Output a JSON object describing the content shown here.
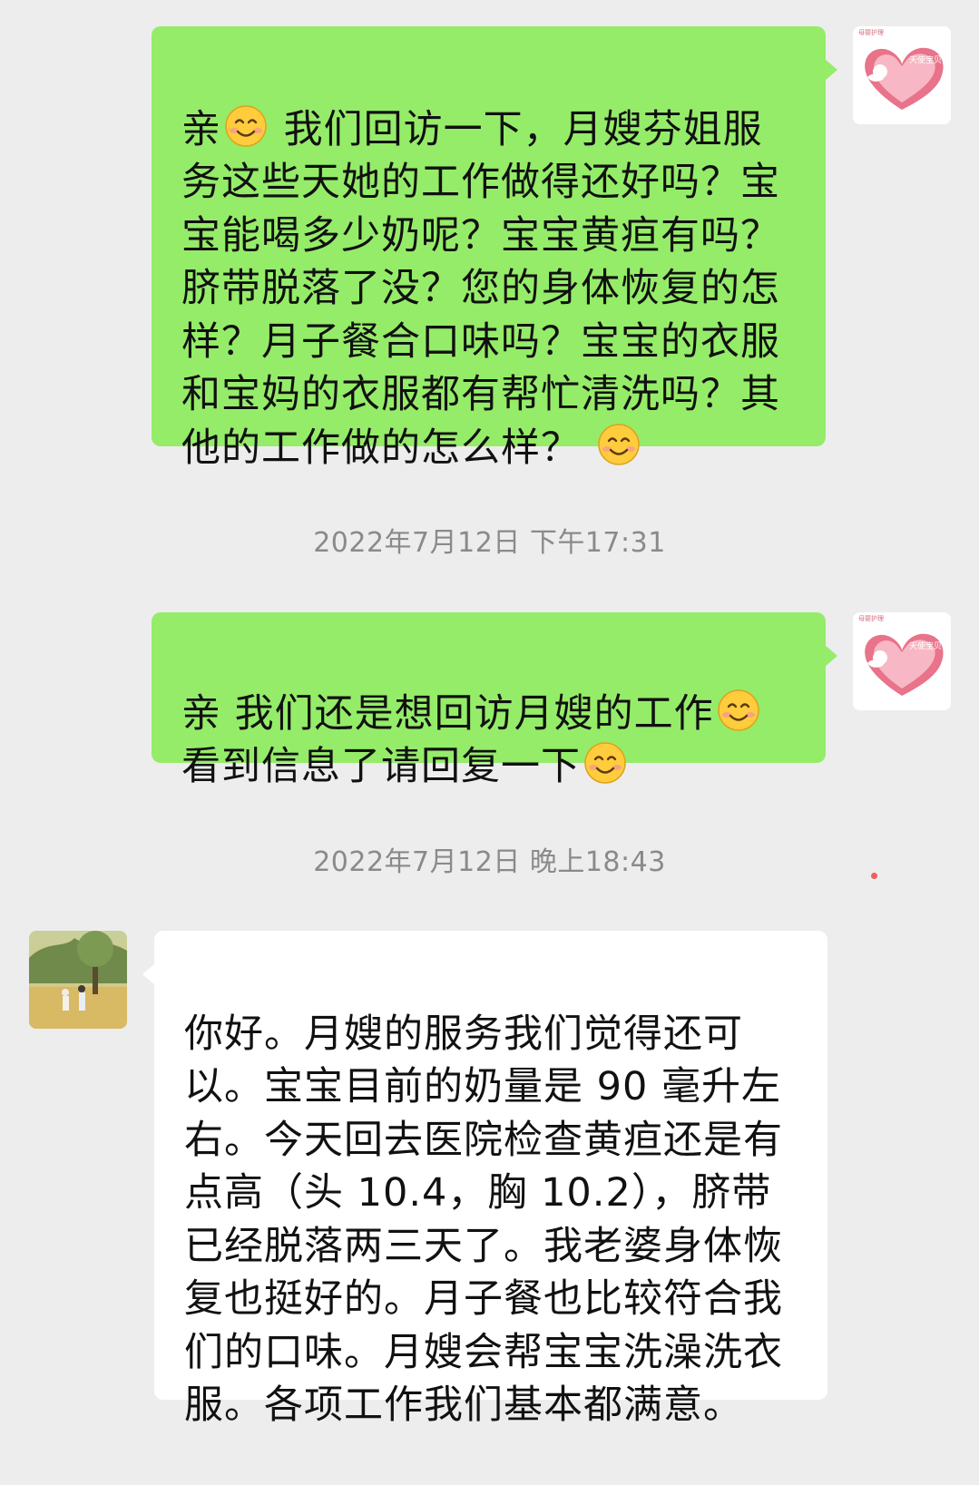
{
  "conversation": {
    "messages": [
      {
        "direction": "out",
        "sender_avatar": "heart-angel-logo",
        "avatar_text": "天使宝贝",
        "avatar_caption": "母婴护理",
        "segments": [
          {
            "type": "text",
            "value": "亲"
          },
          {
            "type": "emoji",
            "value": "smile-emoji"
          },
          {
            "type": "text",
            "value": " 我们回访一下，月嫂芬姐服务这些天她的工作做得还好吗？宝宝能喝多少奶呢？宝宝黄疸有吗？脐带脱落了没？您的身体恢复的怎样？月子餐合口味吗？宝宝的衣服和宝妈的衣服都有帮忙清洗吗？其他的工作做的怎么样？"
          },
          {
            "type": "emoji",
            "value": "smile-emoji"
          }
        ]
      },
      {
        "type": "timestamp",
        "text": "2022年7月12日 下午17:31"
      },
      {
        "direction": "out",
        "sender_avatar": "heart-angel-logo",
        "avatar_text": "天使宝贝",
        "avatar_caption": "母婴护理",
        "segments": [
          {
            "type": "text",
            "value": "亲 我们还是想回访月嫂的工作"
          },
          {
            "type": "emoji",
            "value": "smile-emoji"
          },
          {
            "type": "text",
            "value": "\n看到信息了请回复一下"
          },
          {
            "type": "emoji",
            "value": "smile-emoji"
          }
        ]
      },
      {
        "type": "timestamp",
        "text": "2022年7月12日 晚上18:43"
      },
      {
        "direction": "in",
        "sender_avatar": "couple-photo",
        "segments": [
          {
            "type": "text",
            "value": "你好。月嫂的服务我们觉得还可以。宝宝目前的奶量是 90 毫升左右。今天回去医院检查黄疸还是有点高（头 10.4，胸 10.2），脐带已经脱落两三天了。我老婆身体恢复也挺好的。月子餐也比较符合我们的口味。月嫂会帮宝宝洗澡洗衣服。各项工作我们基本都满意。"
          }
        ]
      }
    ]
  },
  "colors": {
    "background": "#ededed",
    "outgoing_bubble": "#95ec69",
    "incoming_bubble": "#ffffff",
    "timestamp_text": "#8a8a8a",
    "unread_dot": "#f25d5d"
  }
}
